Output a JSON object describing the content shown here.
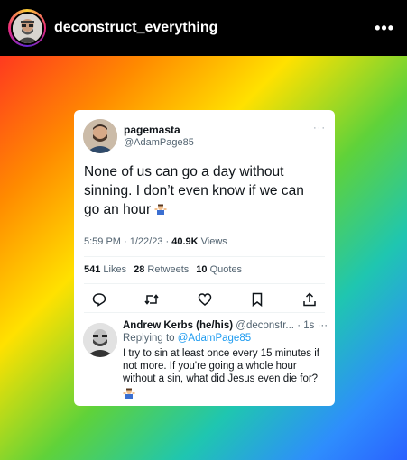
{
  "instagram": {
    "username": "deconstruct_everything",
    "more_label": "•••"
  },
  "tweet": {
    "display_name": "pagemasta",
    "handle": "@AdamPage85",
    "more_label": "···",
    "text": "None of us can go a day without sinning. I don’t even know if we can go an hour",
    "time": "5:59 PM",
    "date": "1/22/23",
    "views_count": "40.9K",
    "views_label": "Views",
    "likes_count": "541",
    "likes_label": "Likes",
    "retweets_count": "28",
    "retweets_label": "Retweets",
    "quotes_count": "10",
    "quotes_label": "Quotes",
    "actions": [
      "reply-icon",
      "retweet-icon",
      "heart-icon",
      "bookmark-icon",
      "share-icon"
    ]
  },
  "reply": {
    "display_name": "Andrew Kerbs (he/his)",
    "handle_time": "@deconstr... · 1s",
    "more_label": "···",
    "replying_prefix": "Replying to",
    "replying_handle": "@AdamPage85",
    "text": "I try to sin at least once every 15 minutes if not more. If you're going a whole hour without a sin, what did Jesus even die for?"
  },
  "colors": {
    "link_blue": "#1d9bf0",
    "text": "#0f1419",
    "muted": "#536471"
  }
}
